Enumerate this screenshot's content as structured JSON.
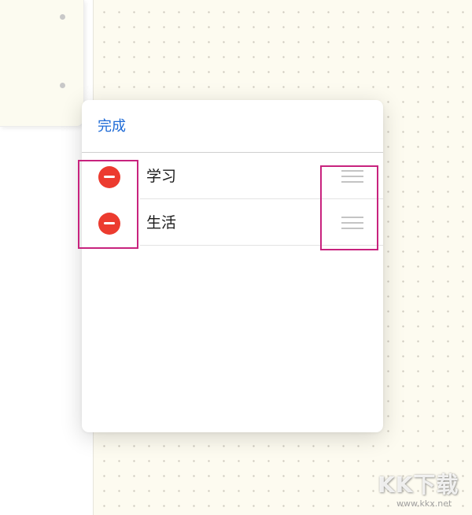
{
  "panel": {
    "done_label": "完成",
    "rows": [
      {
        "label": "学习",
        "delete_icon": "minus-circle-icon",
        "handle_icon": "drag-handle-icon"
      },
      {
        "label": "生活",
        "delete_icon": "minus-circle-icon",
        "handle_icon": "drag-handle-icon"
      }
    ]
  },
  "watermark": {
    "text": "KK下载",
    "url": "www.kkx.net"
  },
  "colors": {
    "accent": "#1d6ad6",
    "delete": "#ec3b2f",
    "highlight": "#c8237e",
    "canvas": "#fdfbf0"
  }
}
